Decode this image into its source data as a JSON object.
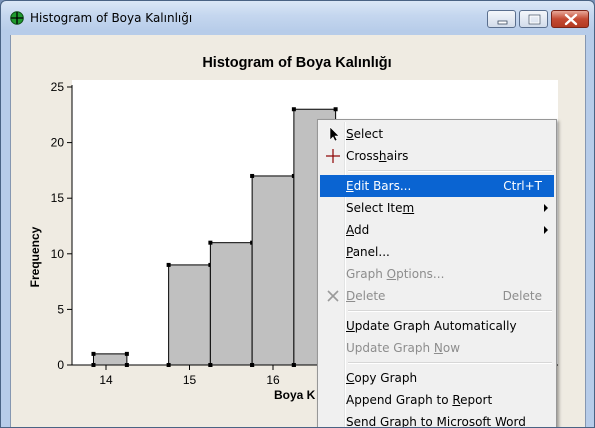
{
  "window": {
    "title": "Histogram of Boya Kalınlığı"
  },
  "graph": {
    "title": "Histogram of Boya Kalınlığı",
    "ylabel": "Frequency",
    "xlabel_visible": "Boya K"
  },
  "chart_data": {
    "type": "bar",
    "title": "Histogram of Boya Kalınlığı",
    "xlabel": "Boya K",
    "ylabel": "Frequency",
    "x_ticks": [
      "14",
      "15",
      "16"
    ],
    "y_ticks": [
      "0",
      "5",
      "10",
      "15",
      "20",
      "25"
    ],
    "ylim": [
      0,
      25
    ],
    "bars": [
      {
        "x_start": 13.85,
        "x_end": 14.25,
        "value": 1
      },
      {
        "x_start": 14.75,
        "x_end": 15.25,
        "value": 9
      },
      {
        "x_start": 15.25,
        "x_end": 15.75,
        "value": 11
      },
      {
        "x_start": 15.75,
        "x_end": 16.25,
        "value": 17
      },
      {
        "x_start": 16.25,
        "x_end": 16.75,
        "value": 23
      }
    ],
    "grid": false
  },
  "context_menu": {
    "items": [
      {
        "label": "Select",
        "icon": "cursor-arrow-icon",
        "state": "normal"
      },
      {
        "label": "Crosshairs",
        "icon": "crosshairs-icon",
        "state": "normal"
      },
      {
        "label": "Edit Bars...",
        "shortcut": "Ctrl+T",
        "state": "highlighted"
      },
      {
        "label": "Select Item",
        "submenu": true,
        "state": "normal"
      },
      {
        "label": "Add",
        "submenu": true,
        "state": "normal"
      },
      {
        "label": "Panel...",
        "state": "normal"
      },
      {
        "label": "Graph Options...",
        "state": "disabled"
      },
      {
        "label": "Delete",
        "shortcut": "Delete",
        "icon": "delete-x-icon",
        "state": "disabled"
      },
      {
        "label": "Update Graph Automatically",
        "state": "normal"
      },
      {
        "label": "Update Graph Now",
        "state": "disabled"
      },
      {
        "label": "Copy Graph",
        "state": "normal"
      },
      {
        "label": "Append Graph to Report",
        "state": "normal"
      },
      {
        "label": "Send Graph to Microsoft Word",
        "state": "normal"
      }
    ]
  }
}
